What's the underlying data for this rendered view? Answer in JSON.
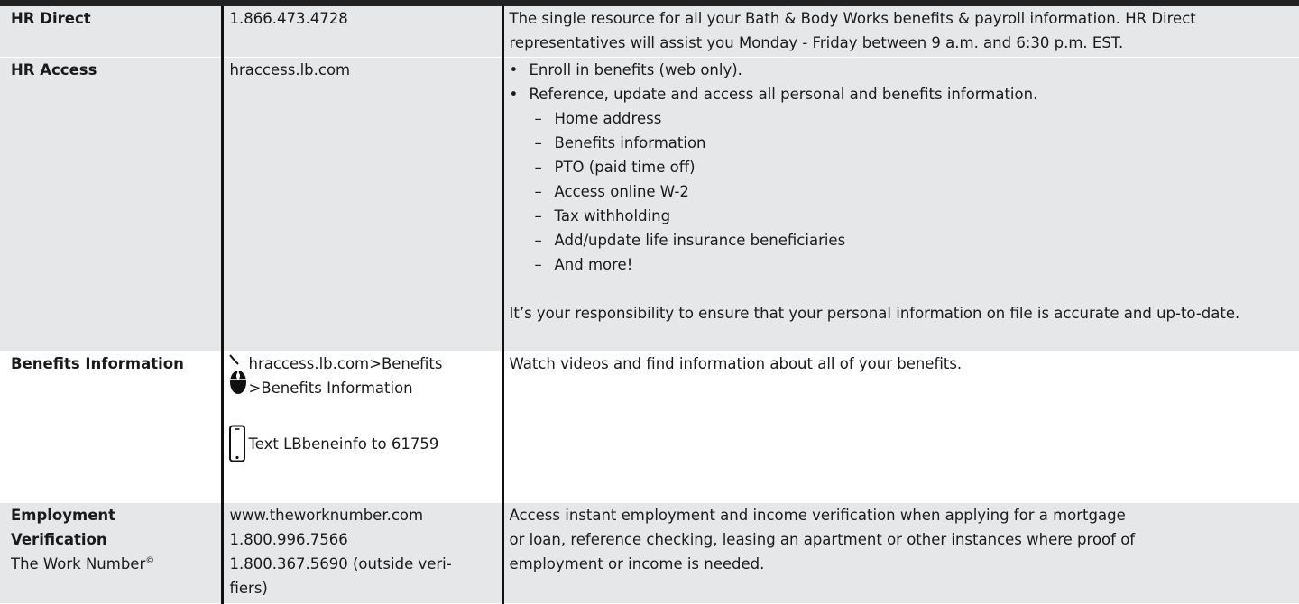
{
  "rows": [
    {
      "label": "HR Direct",
      "contact": "1.866.473.4728",
      "description": "The single resource for all your Bath & Body Works benefits & payroll information. HR Direct representatives will assist you Monday - Friday between 9 a.m. and 6:30 p.m. EST."
    },
    {
      "label": "HR Access",
      "contact": "hraccess.lb.com",
      "bullets": [
        "Enroll in benefits (web only).",
        "Reference, update and access all personal and benefits information."
      ],
      "subitems": [
        "Home address",
        "Benefits information",
        "PTO (paid time off)",
        "Access online W-2",
        "Tax withholding",
        "Add/update life insurance beneficiaries",
        "And more!"
      ],
      "note": "It’s your responsibility to ensure that your personal information on file is accurate and up-to-date."
    },
    {
      "label": "Benefits Information",
      "web_line1": "hraccess.lb.com>Benefits",
      "web_line2": ">Benefits Information",
      "text_line": "Text LBbeneinfo to 61759",
      "description": "Watch videos and find information about all of your benefits."
    },
    {
      "label_line1": "Employment",
      "label_line2": "Verification",
      "label_line3": "The Work Number",
      "label_mark": "©",
      "contact_line1": "www.theworknumber.com",
      "contact_line2": "1.800.996.7566",
      "contact_line3": "1.800.367.5690 (outside veri-",
      "contact_line4": "fiers)",
      "description_line1": "Access instant employment and income verification when applying for a mortgage",
      "description_line2": "or loan, reference checking, leasing an apartment or other instances where proof of",
      "description_line3": "employment or income is needed."
    }
  ],
  "icons": {
    "web": "computer-mouse-icon",
    "text": "mobile-phone-icon"
  }
}
